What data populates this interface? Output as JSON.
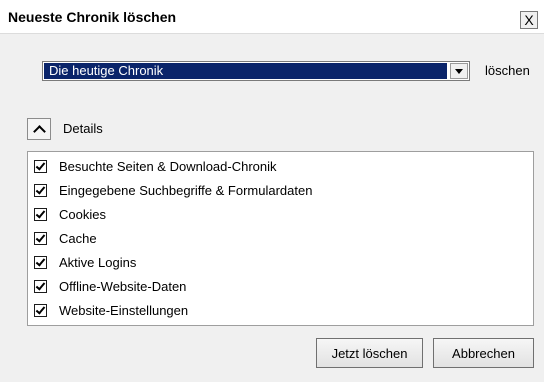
{
  "window": {
    "title": "Neueste Chronik löschen",
    "close_label": "X"
  },
  "range": {
    "selected": "Die heutige Chronik",
    "suffix": "löschen"
  },
  "details": {
    "label": "Details",
    "items": [
      {
        "label": "Besuchte Seiten & Download-Chronik",
        "checked": true
      },
      {
        "label": "Eingegebene Suchbegriffe & Formulardaten",
        "checked": true
      },
      {
        "label": "Cookies",
        "checked": true
      },
      {
        "label": "Cache",
        "checked": true
      },
      {
        "label": "Aktive Logins",
        "checked": true
      },
      {
        "label": "Offline-Website-Daten",
        "checked": true
      },
      {
        "label": "Website-Einstellungen",
        "checked": true
      }
    ]
  },
  "buttons": {
    "confirm": "Jetzt löschen",
    "cancel": "Abbrechen"
  }
}
